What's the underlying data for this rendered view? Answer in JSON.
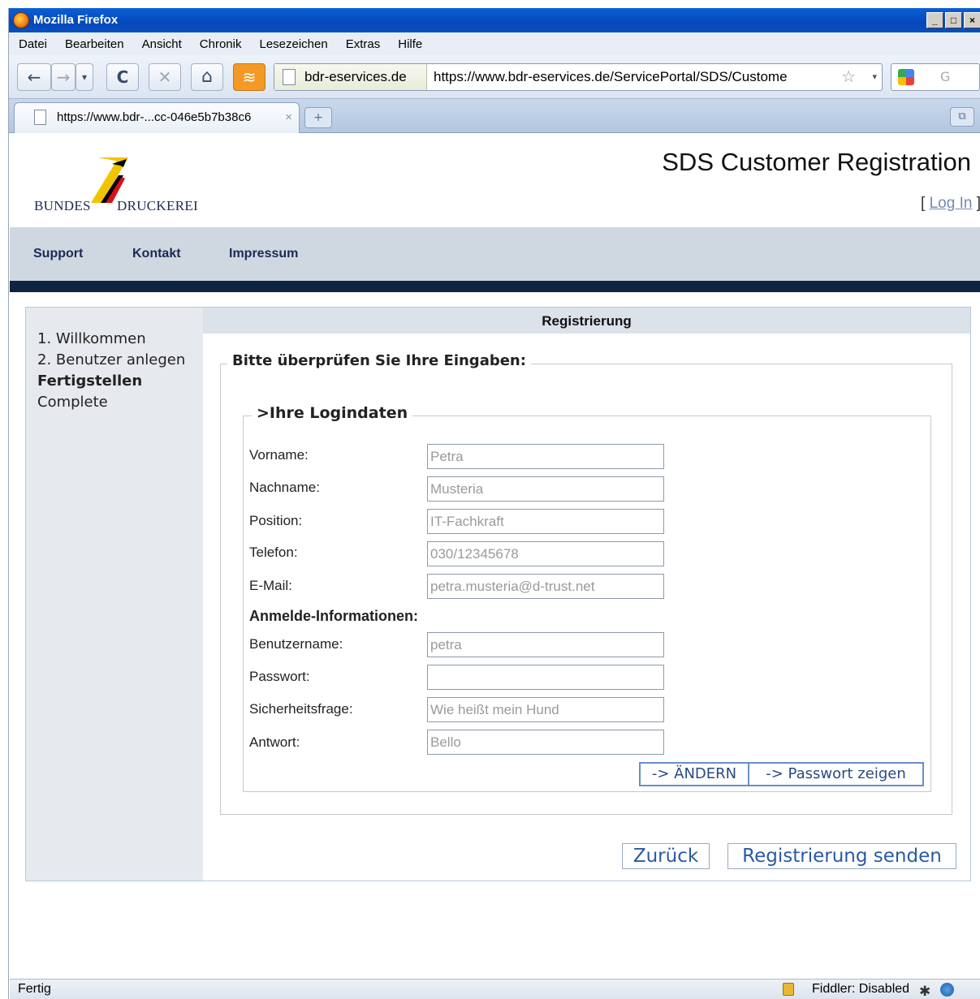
{
  "window": {
    "title": "Mozilla Firefox",
    "controls": [
      "_",
      "□",
      "×"
    ]
  },
  "menu": [
    "Datei",
    "Bearbeiten",
    "Ansicht",
    "Chronik",
    "Lesezeichen",
    "Extras",
    "Hilfe"
  ],
  "nav": {
    "back": "←",
    "forward": "→",
    "history_dropdown": "▾",
    "reload": "C",
    "stop": "✕",
    "home": "⌂",
    "feed": "≋"
  },
  "address": {
    "site": "bdr-eservices.de",
    "url": "https://www.bdr-eservices.de/ServicePortal/SDS/Custome",
    "star": "☆",
    "dropdown": "▾"
  },
  "search": {
    "placeholder": "G"
  },
  "tab": {
    "label": "https://www.bdr-...cc-046e5b7b38c6",
    "close": "×",
    "new_tab": "+",
    "list_all": "⧉"
  },
  "header": {
    "logo_left": "BUNDES",
    "logo_right": "DRUCKEREI",
    "title": "SDS Customer Registration",
    "login_open": "[ ",
    "login_label": "Log In",
    "login_close": " ]"
  },
  "topnav": [
    "Support",
    "Kontakt",
    "Impressum"
  ],
  "steps": [
    "1. Willkommen",
    "2. Benutzer anlegen",
    "Fertigstellen",
    "Complete"
  ],
  "main": {
    "heading": "Registrierung",
    "outer_legend": "Bitte überprüfen Sie Ihre Eingaben:",
    "inner_legend": ">Ihre Logindaten",
    "fields": [
      {
        "label": "Vorname:",
        "value": "Petra"
      },
      {
        "label": "Nachname:",
        "value": "Musteria"
      },
      {
        "label": "Position:",
        "value": "IT-Fachkraft"
      },
      {
        "label": "Telefon:",
        "value": "030/12345678"
      },
      {
        "label": "E-Mail:",
        "value": "petra.musteria@d-trust.net"
      }
    ],
    "subheading": "Anmelde-Informationen:",
    "login_fields": [
      {
        "label": "Benutzername:",
        "value": "petra"
      },
      {
        "label": "Passwort:",
        "value": ""
      },
      {
        "label": "Sicherheitsfrage:",
        "value": "Wie heißt mein Hund"
      },
      {
        "label": "Antwort:",
        "value": "Bello"
      }
    ],
    "change_button": "-> ÄNDERN",
    "show_password_button": "-> Passwort zeigen",
    "back_button": "Zurück",
    "submit_button": "Registrierung senden"
  },
  "status": {
    "left": "Fertig",
    "right": "Fiddler: Disabled"
  }
}
